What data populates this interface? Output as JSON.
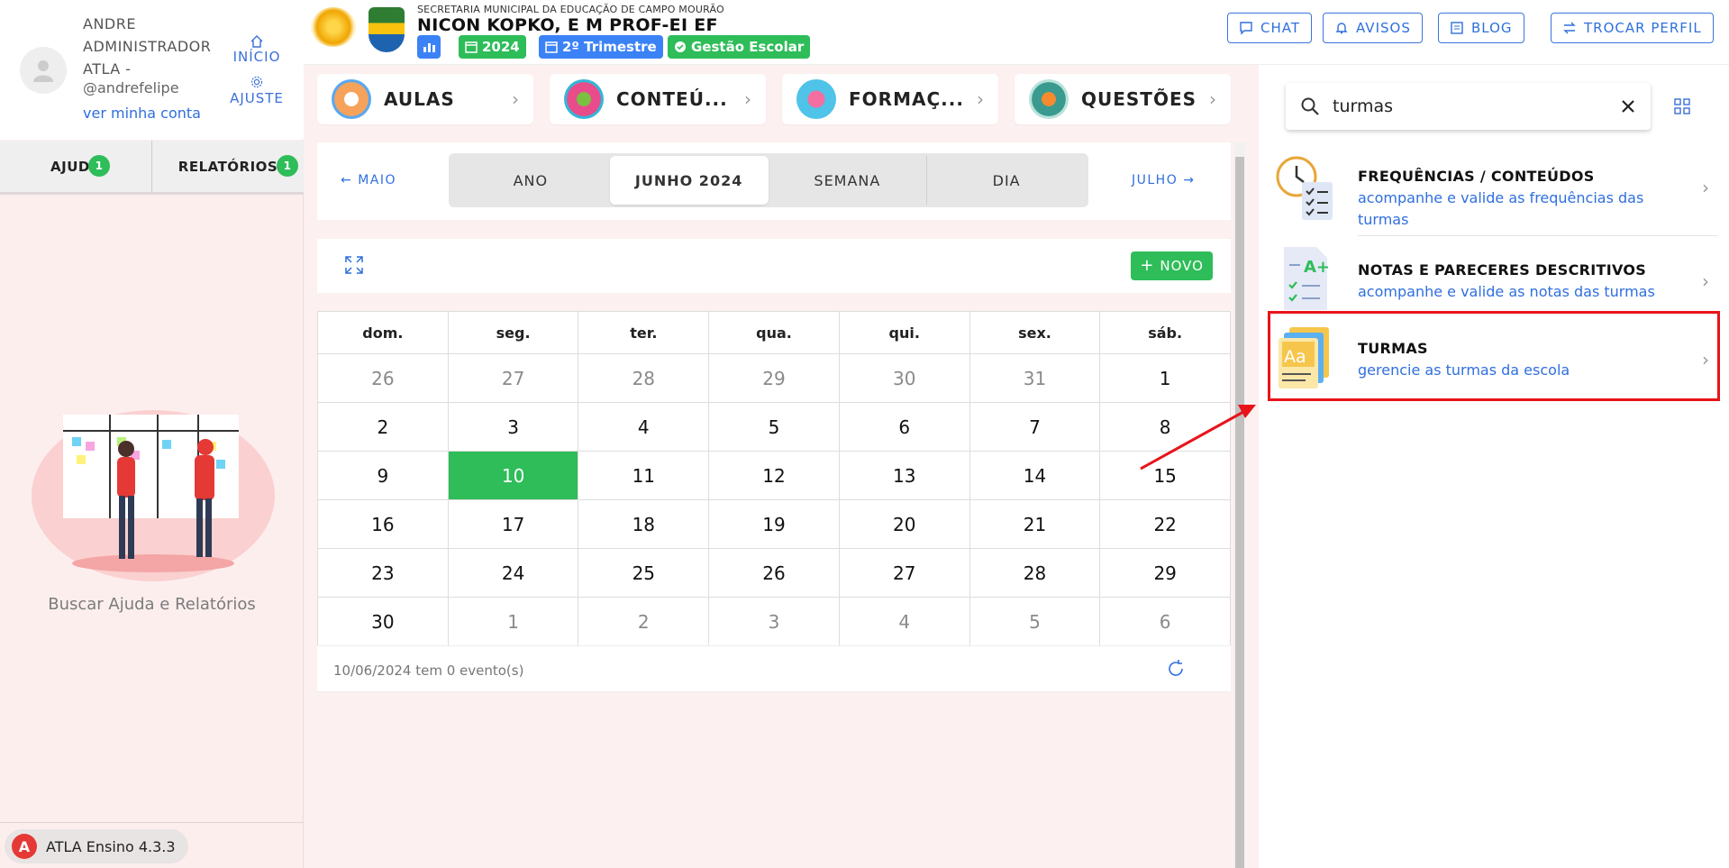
{
  "user": {
    "name": "ANDRE ADMINISTRADOR ATLA -",
    "handle": "@andrefelipe",
    "profile_link": "ver minha conta"
  },
  "side_nav": {
    "home": "INÍCIO",
    "settings": "AJUSTE"
  },
  "side_tabs": [
    {
      "label": "AJUDA",
      "badge": "1"
    },
    {
      "label": "RELATÓRIOS",
      "badge": "1"
    }
  ],
  "help_text": "Buscar Ajuda e Relatórios",
  "version": {
    "logo_letter": "A",
    "label": "ATLA Ensino 4.3.3"
  },
  "header": {
    "secretaria": "SECRETARIA MUNICIPAL DA EDUCAÇÃO DE CAMPO MOURÃO",
    "school": "NICON KOPKO, E M PROF-EI EF",
    "chips": {
      "year": "2024",
      "term": "2º Trimestre",
      "module": "Gestão Escolar"
    },
    "buttons": {
      "chat": "CHAT",
      "avisos": "AVISOS",
      "blog": "BLOG",
      "trocar": "TROCAR PERFIL"
    }
  },
  "shortcuts": [
    "AULAS",
    "CONTEÚ...",
    "FORMAÇ...",
    "QUESTÕES"
  ],
  "calendar": {
    "prev": "MAIO",
    "next": "JULHO",
    "views": [
      "ANO",
      "JUNHO 2024",
      "SEMANA",
      "DIA"
    ],
    "active_view": "JUNHO 2024",
    "new_button": "NOVO",
    "weekdays": [
      "dom.",
      "seg.",
      "ter.",
      "qua.",
      "qui.",
      "sex.",
      "sáb."
    ],
    "weeks": [
      [
        {
          "d": "26",
          "m": true
        },
        {
          "d": "27",
          "m": true
        },
        {
          "d": "28",
          "m": true
        },
        {
          "d": "29",
          "m": true
        },
        {
          "d": "30",
          "m": true
        },
        {
          "d": "31",
          "m": true
        },
        {
          "d": "1"
        }
      ],
      [
        {
          "d": "2"
        },
        {
          "d": "3"
        },
        {
          "d": "4"
        },
        {
          "d": "5"
        },
        {
          "d": "6"
        },
        {
          "d": "7"
        },
        {
          "d": "8"
        }
      ],
      [
        {
          "d": "9"
        },
        {
          "d": "10",
          "today": true
        },
        {
          "d": "11"
        },
        {
          "d": "12"
        },
        {
          "d": "13"
        },
        {
          "d": "14"
        },
        {
          "d": "15"
        }
      ],
      [
        {
          "d": "16"
        },
        {
          "d": "17"
        },
        {
          "d": "18"
        },
        {
          "d": "19"
        },
        {
          "d": "20"
        },
        {
          "d": "21"
        },
        {
          "d": "22"
        }
      ],
      [
        {
          "d": "23"
        },
        {
          "d": "24"
        },
        {
          "d": "25"
        },
        {
          "d": "26"
        },
        {
          "d": "27"
        },
        {
          "d": "28"
        },
        {
          "d": "29"
        }
      ],
      [
        {
          "d": "30"
        },
        {
          "d": "1",
          "m": true
        },
        {
          "d": "2",
          "m": true
        },
        {
          "d": "3",
          "m": true
        },
        {
          "d": "4",
          "m": true
        },
        {
          "d": "5",
          "m": true
        },
        {
          "d": "6",
          "m": true
        }
      ]
    ],
    "events_text": "10/06/2024 tem 0 evento(s)"
  },
  "search": {
    "value": "turmas"
  },
  "results": [
    {
      "title": "FREQUÊNCIAS / CONTEÚDOS",
      "desc": "acompanhe e valide as frequências das turmas",
      "icon": "clock-checklist-icon"
    },
    {
      "title": "NOTAS E PARECERES DESCRITIVOS",
      "desc": "acompanhe e valide as notas das turmas",
      "icon": "grade-document-icon"
    },
    {
      "title": "TURMAS",
      "desc": "gerencie as turmas da escola",
      "icon": "class-document-icon"
    }
  ],
  "colors": {
    "accent": "#2f6fde",
    "green": "#2ebd59",
    "highlight": "#e8141a",
    "chip_blue": "#3b82f6"
  }
}
